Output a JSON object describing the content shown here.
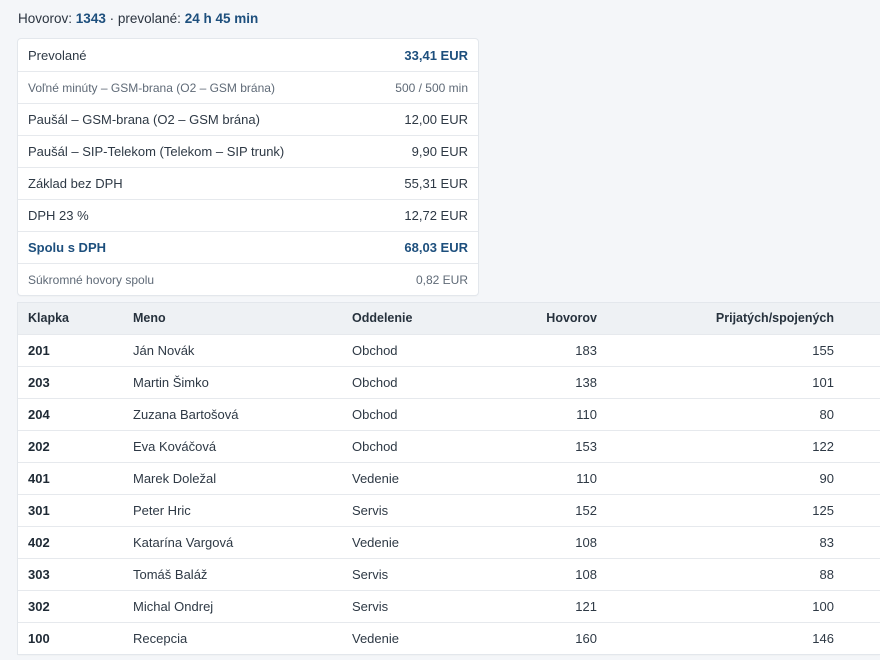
{
  "summary": {
    "calls_label": "Hovorov:",
    "calls_value": "1343",
    "separator": "·",
    "duration_label": "prevolané:",
    "duration_value": "24 h 45 min"
  },
  "costs": {
    "rows": [
      {
        "label": "Prevolané",
        "value": "33,41 EUR"
      },
      {
        "label": "Voľné minúty – GSM-brana (O2 – GSM brána)",
        "value": "500 / 500 min"
      },
      {
        "label": "Paušál – GSM-brana (O2 – GSM brána)",
        "value": "12,00 EUR"
      },
      {
        "label": "Paušál – SIP-Telekom (Telekom – SIP trunk)",
        "value": "9,90 EUR"
      },
      {
        "label": "Základ bez DPH",
        "value": "55,31 EUR"
      },
      {
        "label": "DPH 23 %",
        "value": "12,72 EUR"
      },
      {
        "label": "Spolu s DPH",
        "value": "68,03 EUR"
      },
      {
        "label": "Súkromné hovory spolu",
        "value": "0,82 EUR"
      }
    ]
  },
  "table": {
    "headers": {
      "extension": "Klapka",
      "name": "Meno",
      "department": "Oddelenie",
      "calls": "Hovorov",
      "answered": "Prijatých/spojených"
    },
    "rows": [
      {
        "extension": "201",
        "name": "Ján Novák",
        "department": "Obchod",
        "calls": "183",
        "answered": "155"
      },
      {
        "extension": "203",
        "name": "Martin Šimko",
        "department": "Obchod",
        "calls": "138",
        "answered": "101"
      },
      {
        "extension": "204",
        "name": "Zuzana Bartošová",
        "department": "Obchod",
        "calls": "110",
        "answered": "80"
      },
      {
        "extension": "202",
        "name": "Eva Kováčová",
        "department": "Obchod",
        "calls": "153",
        "answered": "122"
      },
      {
        "extension": "401",
        "name": "Marek Doležal",
        "department": "Vedenie",
        "calls": "110",
        "answered": "90"
      },
      {
        "extension": "301",
        "name": "Peter Hric",
        "department": "Servis",
        "calls": "152",
        "answered": "125"
      },
      {
        "extension": "402",
        "name": "Katarína Vargová",
        "department": "Vedenie",
        "calls": "108",
        "answered": "83"
      },
      {
        "extension": "303",
        "name": "Tomáš Baláž",
        "department": "Servis",
        "calls": "108",
        "answered": "88"
      },
      {
        "extension": "302",
        "name": "Michal Ondrej",
        "department": "Servis",
        "calls": "121",
        "answered": "100"
      },
      {
        "extension": "100",
        "name": "Recepcia",
        "department": "Vedenie",
        "calls": "160",
        "answered": "146"
      }
    ]
  },
  "colors": {
    "accent": "#1d4f7d",
    "background": "#f4f6f9",
    "header_bg": "#eef1f4"
  }
}
